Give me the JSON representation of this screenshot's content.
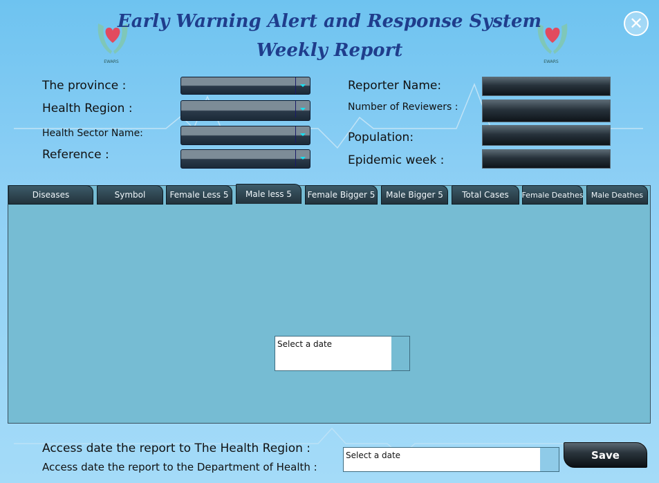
{
  "header": {
    "title_line1": "Early Warning Alert and Response System",
    "title_line2": "Weekly Report",
    "logo_caption": "EWARS",
    "close_icon": "close-icon"
  },
  "form": {
    "province_label": "The province :",
    "health_region_label": "Health Region :",
    "health_sector_label": "Health Sector Name:",
    "reference_label": "Reference :",
    "reporter_name_label": "Reporter Name:",
    "num_reviewers_label": "Number of Reviewers :",
    "population_label": "Population:",
    "epidemic_week_label": "Epidemic week :"
  },
  "tabs": [
    {
      "label": "Diseases"
    },
    {
      "label": "Symbol"
    },
    {
      "label": "Female Less 5"
    },
    {
      "label": "Male less 5"
    },
    {
      "label": "Female Bigger 5"
    },
    {
      "label": "Male Bigger 5"
    },
    {
      "label": "Total Cases"
    },
    {
      "label": "Female Deathes"
    },
    {
      "label": "Male Deathes"
    }
  ],
  "active_tab": "Male less 5",
  "panel": {
    "date_placeholder": "Select a date"
  },
  "footer": {
    "access_health_region_label": "Access date the report to The Health Region :",
    "access_department_label": "Access date the report to the Department of Health :",
    "date_placeholder": "Select a date",
    "save_label": "Save"
  },
  "colors": {
    "title": "#1f3d8c",
    "background_top": "#6ec3f0",
    "panel": "#76bcd3",
    "combo_arrow": "#18e0f0"
  }
}
